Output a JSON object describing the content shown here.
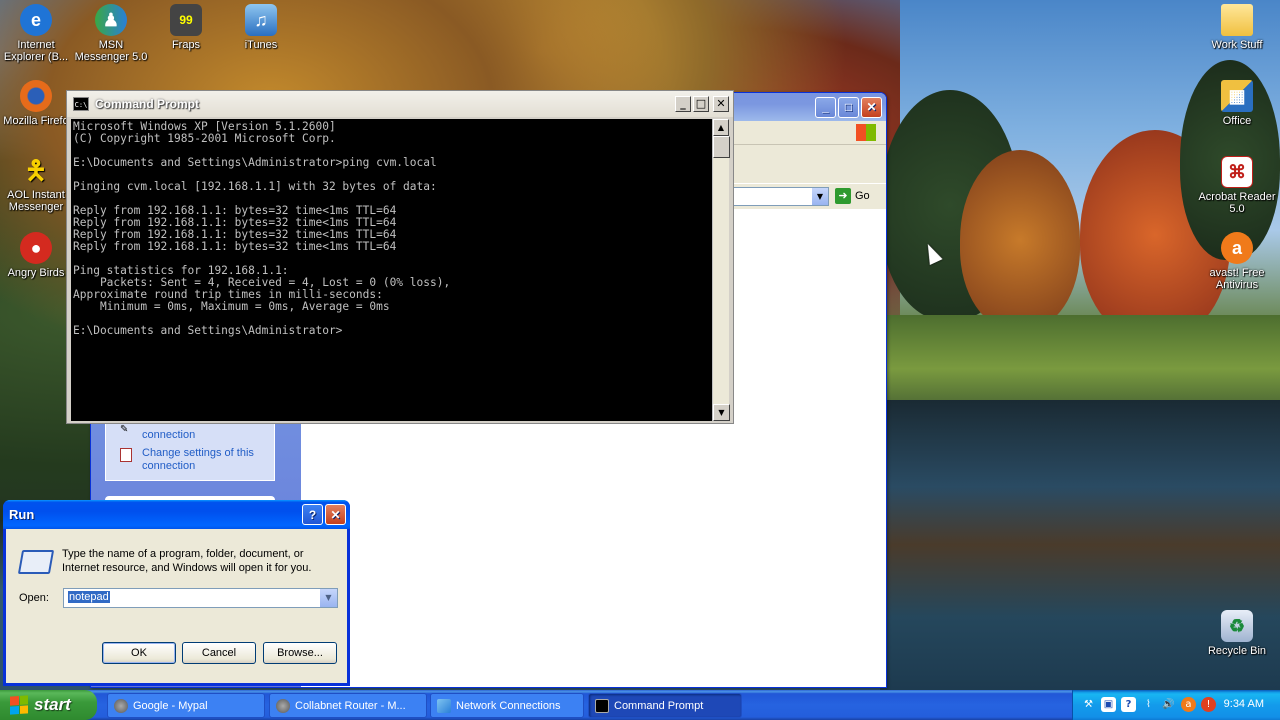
{
  "desktop": {
    "icons_left": [
      {
        "label": "Internet Explorer (B...",
        "icon": "internet-explorer-icon"
      },
      {
        "label": "MSN Messenger 5.0",
        "icon": "msn-messenger-icon"
      },
      {
        "label": "Fraps",
        "icon": "fraps-icon"
      },
      {
        "label": "iTunes",
        "icon": "itunes-icon"
      },
      {
        "label": "Mozilla Firefo",
        "icon": "firefox-icon"
      },
      {
        "label": "AOL Instant Messenger",
        "icon": "aim-icon"
      },
      {
        "label": "Angry Birds",
        "icon": "angry-birds-icon"
      }
    ],
    "icons_right": [
      {
        "label": "Work Stuff",
        "icon": "folder-icon"
      },
      {
        "label": "Office",
        "icon": "office-icon"
      },
      {
        "label": "Acrobat Reader 5.0",
        "icon": "acrobat-icon"
      },
      {
        "label": "avast! Free Antivirus",
        "icon": "avast-icon"
      },
      {
        "label": "Recycle Bin",
        "icon": "recycle-bin-icon"
      }
    ],
    "fraps_badge": "99"
  },
  "command_prompt": {
    "title": "Command Prompt",
    "icon_text": "C:\\",
    "lines": [
      "Microsoft Windows XP [Version 5.1.2600]",
      "(C) Copyright 1985-2001 Microsoft Corp.",
      "",
      "E:\\Documents and Settings\\Administrator>ping cvm.local",
      "",
      "Pinging cvm.local [192.168.1.1] with 32 bytes of data:",
      "",
      "Reply from 192.168.1.1: bytes=32 time<1ms TTL=64",
      "Reply from 192.168.1.1: bytes=32 time<1ms TTL=64",
      "Reply from 192.168.1.1: bytes=32 time<1ms TTL=64",
      "Reply from 192.168.1.1: bytes=32 time<1ms TTL=64",
      "",
      "Ping statistics for 192.168.1.1:",
      "    Packets: Sent = 4, Received = 4, Lost = 0 (0% loss),",
      "Approximate round trip times in milli-seconds:",
      "    Minimum = 0ms, Maximum = 0ms, Average = 0ms",
      "",
      "E:\\Documents and Settings\\Administrator>"
    ]
  },
  "network_window": {
    "go_label": "Go",
    "task_links": [
      "connection",
      "Change settings of this connection"
    ]
  },
  "run_dialog": {
    "title": "Run",
    "description": "Type the name of a program, folder, document, or Internet resource, and Windows will open it for you.",
    "open_label": "Open:",
    "open_value": "notepad",
    "ok_label": "OK",
    "cancel_label": "Cancel",
    "browse_label": "Browse..."
  },
  "taskbar": {
    "start_label": "start",
    "items": [
      {
        "label": "Google - Mypal",
        "icon": "mypal-icon"
      },
      {
        "label": "Collabnet Router - M...",
        "icon": "mypal-icon"
      },
      {
        "label": "Network Connections",
        "icon": "network-connections-icon"
      },
      {
        "label": "Command Prompt",
        "icon": "command-prompt-icon"
      }
    ],
    "clock": "9:34 AM"
  }
}
